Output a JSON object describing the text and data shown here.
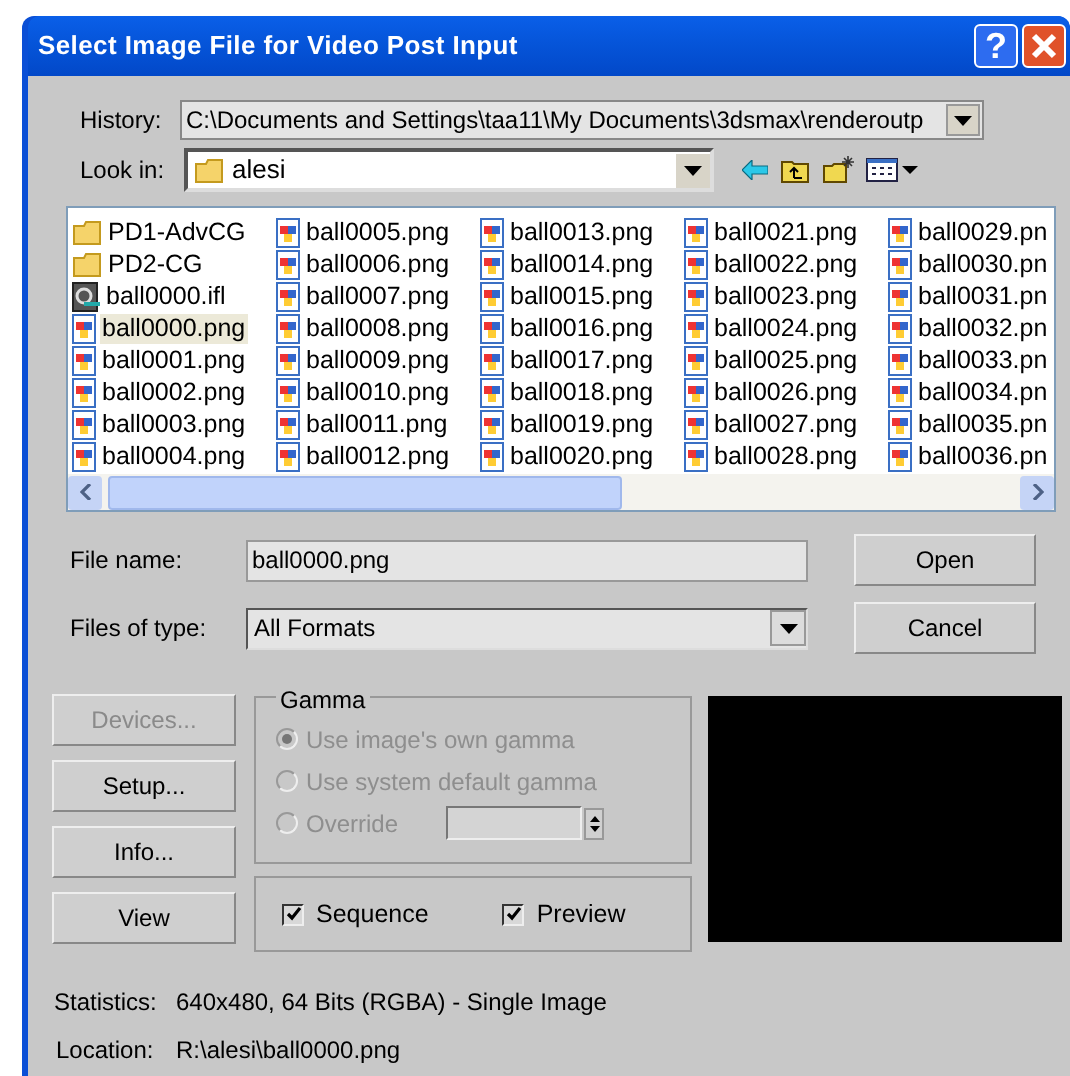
{
  "window": {
    "title": "Select Image File for Video Post Input",
    "help": "?"
  },
  "history": {
    "label": "History:",
    "value": "C:\\Documents and Settings\\taa11\\My Documents\\3dsmax\\renderoutp"
  },
  "look_in": {
    "label": "Look in:",
    "value": "alesi"
  },
  "files": [
    {
      "name": "PD1-AdvCG",
      "kind": "folder",
      "selected": false
    },
    {
      "name": "PD2-CG",
      "kind": "folder",
      "selected": false
    },
    {
      "name": "ball0000.ifl",
      "kind": "ifl",
      "selected": false
    },
    {
      "name": "ball0000.png",
      "kind": "image",
      "selected": true
    },
    {
      "name": "ball0001.png",
      "kind": "image",
      "selected": false
    },
    {
      "name": "ball0002.png",
      "kind": "image",
      "selected": false
    },
    {
      "name": "ball0003.png",
      "kind": "image",
      "selected": false
    },
    {
      "name": "ball0004.png",
      "kind": "image",
      "selected": false
    },
    {
      "name": "ball0005.png",
      "kind": "image",
      "selected": false
    },
    {
      "name": "ball0006.png",
      "kind": "image",
      "selected": false
    },
    {
      "name": "ball0007.png",
      "kind": "image",
      "selected": false
    },
    {
      "name": "ball0008.png",
      "kind": "image",
      "selected": false
    },
    {
      "name": "ball0009.png",
      "kind": "image",
      "selected": false
    },
    {
      "name": "ball0010.png",
      "kind": "image",
      "selected": false
    },
    {
      "name": "ball0011.png",
      "kind": "image",
      "selected": false
    },
    {
      "name": "ball0012.png",
      "kind": "image",
      "selected": false
    },
    {
      "name": "ball0013.png",
      "kind": "image",
      "selected": false
    },
    {
      "name": "ball0014.png",
      "kind": "image",
      "selected": false
    },
    {
      "name": "ball0015.png",
      "kind": "image",
      "selected": false
    },
    {
      "name": "ball0016.png",
      "kind": "image",
      "selected": false
    },
    {
      "name": "ball0017.png",
      "kind": "image",
      "selected": false
    },
    {
      "name": "ball0018.png",
      "kind": "image",
      "selected": false
    },
    {
      "name": "ball0019.png",
      "kind": "image",
      "selected": false
    },
    {
      "name": "ball0020.png",
      "kind": "image",
      "selected": false
    },
    {
      "name": "ball0021.png",
      "kind": "image",
      "selected": false
    },
    {
      "name": "ball0022.png",
      "kind": "image",
      "selected": false
    },
    {
      "name": "ball0023.png",
      "kind": "image",
      "selected": false
    },
    {
      "name": "ball0024.png",
      "kind": "image",
      "selected": false
    },
    {
      "name": "ball0025.png",
      "kind": "image",
      "selected": false
    },
    {
      "name": "ball0026.png",
      "kind": "image",
      "selected": false
    },
    {
      "name": "ball0027.png",
      "kind": "image",
      "selected": false
    },
    {
      "name": "ball0028.png",
      "kind": "image",
      "selected": false
    },
    {
      "name": "ball0029.pn",
      "kind": "image",
      "selected": false
    },
    {
      "name": "ball0030.pn",
      "kind": "image",
      "selected": false
    },
    {
      "name": "ball0031.pn",
      "kind": "image",
      "selected": false
    },
    {
      "name": "ball0032.pn",
      "kind": "image",
      "selected": false
    },
    {
      "name": "ball0033.pn",
      "kind": "image",
      "selected": false
    },
    {
      "name": "ball0034.pn",
      "kind": "image",
      "selected": false
    },
    {
      "name": "ball0035.pn",
      "kind": "image",
      "selected": false
    },
    {
      "name": "ball0036.pn",
      "kind": "image",
      "selected": false
    }
  ],
  "file_name": {
    "label": "File name:",
    "value": "ball0000.png"
  },
  "file_type": {
    "label": "Files of type:",
    "value": "All Formats"
  },
  "action_buttons": [
    "Open",
    "Cancel"
  ],
  "side_buttons": [
    {
      "label": "Devices...",
      "disabled": true
    },
    {
      "label": "Setup...",
      "disabled": false
    },
    {
      "label": "Info...",
      "disabled": false
    },
    {
      "label": "View",
      "disabled": false
    }
  ],
  "gamma": {
    "title": "Gamma",
    "disabled": true,
    "options": [
      {
        "label": "Use image's own gamma",
        "selected": true
      },
      {
        "label": "Use system default gamma",
        "selected": false
      },
      {
        "label": "Override",
        "selected": false
      }
    ]
  },
  "checkboxes": [
    {
      "label": "Sequence",
      "checked": true
    },
    {
      "label": "Preview",
      "checked": true
    }
  ],
  "statistics": {
    "label": "Statistics:",
    "value": "640x480, 64 Bits (RGBA) - Single Image"
  },
  "location": {
    "label": "Location:",
    "value": "R:\\alesi\\ball0000.png"
  }
}
